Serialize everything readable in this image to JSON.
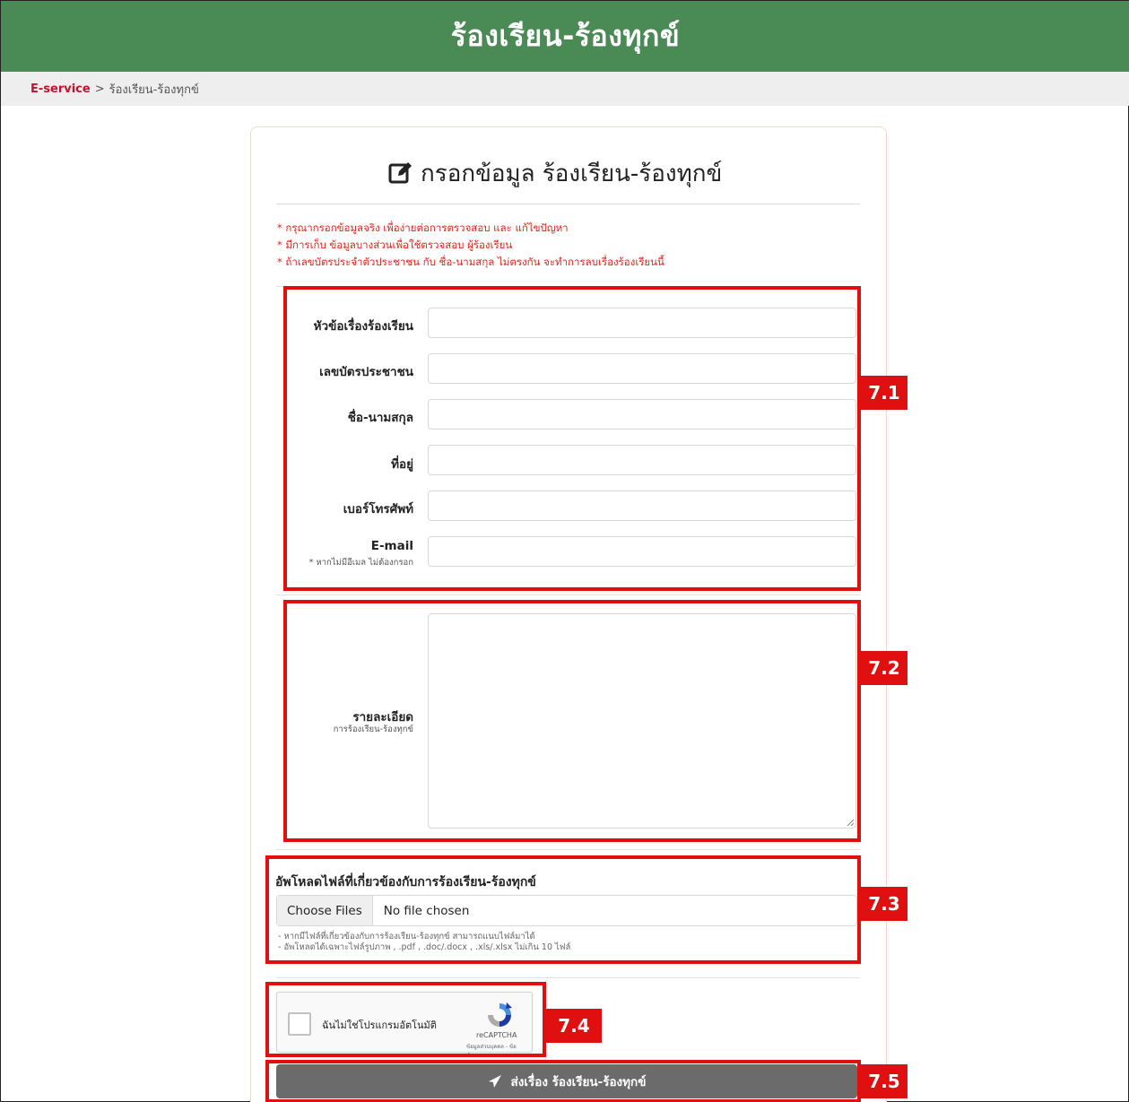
{
  "header": {
    "title": "ร้องเรียน-ร้องทุกข์"
  },
  "breadcrumb": {
    "link": "E-service",
    "separator": ">",
    "current": "ร้องเรียน-ร้องทุกข์"
  },
  "form": {
    "title": "กรอกข้อมูล ร้องเรียน-ร้องทุกข์",
    "notes": [
      "* กรุณากรอกข้อมูลจริง เพื่อง่ายต่อการตรวจสอบ และ แก้ไขปัญหา",
      "* มีการเก็บ ข้อมูลบางส่วนเพื่อใช้ตรวจสอบ ผู้ร้องเรียน",
      "* ถ้าเลขบัตรประจำตัวประชาชน กับ ชื่อ-นามสกุล ไม่ตรงกัน จะทำการลบเรื่องร้องเรียนนี้"
    ],
    "fields": {
      "subject": {
        "label": "หัวข้อเรื่องร้องเรียน",
        "value": ""
      },
      "id_card": {
        "label": "เลขบัตรประชาชน",
        "value": ""
      },
      "fullname": {
        "label": "ชื่อ-นามสกุล",
        "value": ""
      },
      "address": {
        "label": "ที่อยู่",
        "value": ""
      },
      "phone": {
        "label": "เบอร์โทรศัพท์",
        "value": ""
      },
      "email": {
        "label": "E-mail",
        "sublabel": "* หากไม่มีอีเมล ไม่ต้องกรอก",
        "value": ""
      },
      "detail": {
        "label": "รายละเอียด",
        "sublabel": "การร้องเรียน-ร้องทุกข์",
        "value": ""
      }
    },
    "upload": {
      "title": "อัพโหลดไฟล์ที่เกี่ยวข้องกับการร้องเรียน-ร้องทุกข์",
      "button": "Choose Files",
      "status": "No file chosen",
      "notes": [
        "- หากมีไฟล์ที่เกี่ยวข้องกับการร้องเรียน-ร้องทุกข์ สามารถแนบไฟล์มาได้",
        "- อัพโหลดได้เฉพาะไฟล์รูปภาพ , .pdf , .doc/.docx , .xls/.xlsx ไม่เกิน 10 ไฟล์"
      ]
    },
    "captcha": {
      "label": "ฉันไม่ใช่โปรแกรมอัตโนมัติ",
      "brand": "reCAPTCHA",
      "links": "ข้อมูลส่วนบุคคล - ข้อกำหนด"
    },
    "submit": "ส่งเรื่อง ร้องเรียน-ร้องทุกข์"
  },
  "annotations": [
    "7.1",
    "7.2",
    "7.3",
    "7.4",
    "7.5"
  ],
  "colors": {
    "header_bg": "#4a8a55",
    "annotation": "#e01010",
    "note_text": "#e0251b",
    "submit_bg": "#6b6b6b"
  },
  "icons": {
    "title": "edit-icon",
    "submit": "send-icon",
    "captcha": "recaptcha-logo-icon"
  }
}
